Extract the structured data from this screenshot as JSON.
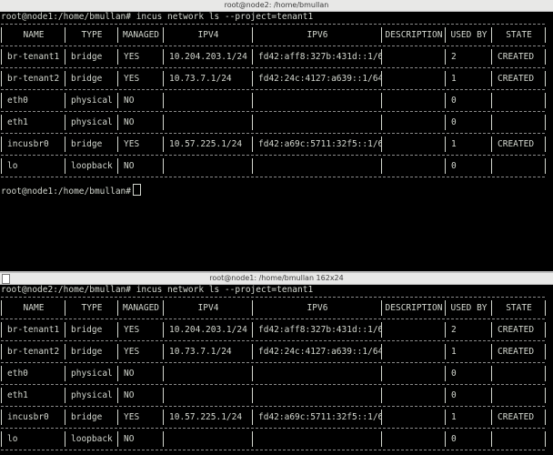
{
  "top_window": {
    "title": "root@node2: /home/bmullan",
    "command_line": "root@node1:/home/bmullan# incus network ls --project=tenant1",
    "after_prompt": "root@node1:/home/bmullan#"
  },
  "bottom_window": {
    "title": "root@node1: /home/bmullan 162x24",
    "command_line": "root@node2:/home/bmullan# incus network ls --project=tenant1"
  },
  "table": {
    "headers": [
      "NAME",
      "TYPE",
      "MANAGED",
      "IPV4",
      "IPV6",
      "DESCRIPTION",
      "USED BY",
      "STATE"
    ],
    "rows": [
      [
        "br-tenant1",
        "bridge",
        "YES",
        "10.204.203.1/24",
        "fd42:aff8:327b:431d::1/64",
        "",
        "2",
        "CREATED"
      ],
      [
        "br-tenant2",
        "bridge",
        "YES",
        "10.73.7.1/24",
        "fd42:24c:4127:a639::1/64",
        "",
        "1",
        "CREATED"
      ],
      [
        "eth0",
        "physical",
        "NO",
        "",
        "",
        "",
        "0",
        ""
      ],
      [
        "eth1",
        "physical",
        "NO",
        "",
        "",
        "",
        "0",
        ""
      ],
      [
        "incusbr0",
        "bridge",
        "YES",
        "10.57.225.1/24",
        "fd42:a69c:5711:32f5::1/64",
        "",
        "1",
        "CREATED"
      ],
      [
        "lo",
        "loopback",
        "NO",
        "",
        "",
        "",
        "0",
        ""
      ]
    ]
  },
  "icons": {
    "cursor": "block-cursor-icon",
    "resize": "window-resize-icon"
  }
}
